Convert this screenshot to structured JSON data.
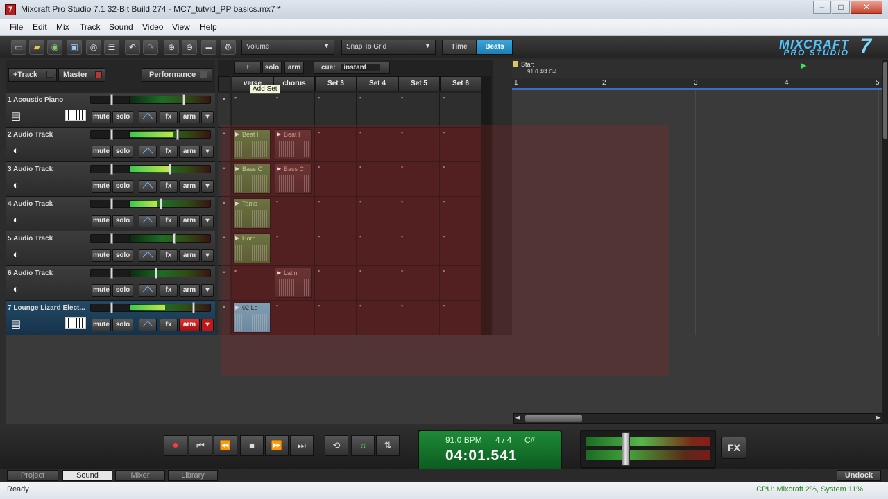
{
  "window": {
    "title": "Mixcraft Pro Studio 7.1 32-Bit Build 274 - MC7_tutvid_PP basics.mx7 *",
    "icon": "7"
  },
  "menu": [
    "File",
    "Edit",
    "Mix",
    "Track",
    "Sound",
    "Video",
    "View",
    "Help"
  ],
  "toolbar": {
    "volume_select": "Volume",
    "snap_select": "Snap To Grid",
    "time_btn": "Time",
    "beats_btn": "Beats"
  },
  "logo": {
    "line1": "MIXCRAFT",
    "line2": "PRO STUDIO",
    "number": "7"
  },
  "panel": {
    "add_track": "+Track",
    "master": "Master",
    "performance": "Performance"
  },
  "tracks": [
    {
      "name": "1 Acoustic Piano",
      "icon": "keyboard-icon",
      "vol": 0.55,
      "pan": 0.68,
      "level": 0.0,
      "armed": false
    },
    {
      "name": "2 Audio Track",
      "icon": "audio-icon",
      "vol": 0.55,
      "pan": 0.6,
      "level": 0.55,
      "armed": false
    },
    {
      "name": "3 Audio Track",
      "icon": "audio-icon",
      "vol": 0.55,
      "pan": 0.5,
      "level": 0.5,
      "armed": false
    },
    {
      "name": "4 Audio Track",
      "icon": "audio-icon",
      "vol": 0.55,
      "pan": 0.38,
      "level": 0.35,
      "armed": false
    },
    {
      "name": "5 Audio Track",
      "icon": "audio-icon",
      "vol": 0.55,
      "pan": 0.55,
      "level": 0.0,
      "armed": false
    },
    {
      "name": "6 Audio Track",
      "icon": "audio-icon",
      "vol": 0.55,
      "pan": 0.32,
      "level": 0.0,
      "armed": false
    },
    {
      "name": "7 Lounge Lizard Elect...",
      "icon": "keyboard-icon",
      "vol": 0.55,
      "pan": 0.8,
      "level": 0.45,
      "armed": true
    }
  ],
  "track_buttons": {
    "mute": "mute",
    "solo": "solo",
    "fx": "fx",
    "arm": "arm"
  },
  "launcher": {
    "top_buttons": [
      "+",
      "solo",
      "arm"
    ],
    "tooltip": "Add Set",
    "cue_label": "cue:",
    "cue_value": "instant",
    "columns": [
      "verse",
      "chorus",
      "Set 3",
      "Set 4",
      "Set 5",
      "Set 6"
    ],
    "clips": [
      {
        "row": 1,
        "col": 0,
        "name": "Beat I",
        "style": "green"
      },
      {
        "row": 1,
        "col": 1,
        "name": "Beat I",
        "style": "red"
      },
      {
        "row": 2,
        "col": 0,
        "name": "Bass C",
        "style": "green"
      },
      {
        "row": 2,
        "col": 1,
        "name": "Bass C",
        "style": "red"
      },
      {
        "row": 3,
        "col": 0,
        "name": "Tamb",
        "style": "green"
      },
      {
        "row": 4,
        "col": 0,
        "name": "Horn",
        "style": "green"
      },
      {
        "row": 5,
        "col": 1,
        "name": "Latin",
        "style": "red"
      },
      {
        "row": 6,
        "col": 0,
        "name": "02 Lo",
        "style": "blue"
      }
    ]
  },
  "timeline": {
    "marker_label": "Start",
    "marker_info": "91.0 4/4 C#",
    "ruler": [
      "1",
      "2",
      "3",
      "4",
      "5"
    ]
  },
  "transport": {
    "bpm": "91.0 BPM",
    "signature": "4 / 4",
    "key": "C#",
    "time": "04:01.541",
    "fx": "FX"
  },
  "tabs": [
    "Project",
    "Sound",
    "Mixer",
    "Library"
  ],
  "active_tab": "Sound",
  "undock": "Undock",
  "status": {
    "left": "Ready",
    "right": "CPU: Mixcraft 2%, System 11%"
  }
}
